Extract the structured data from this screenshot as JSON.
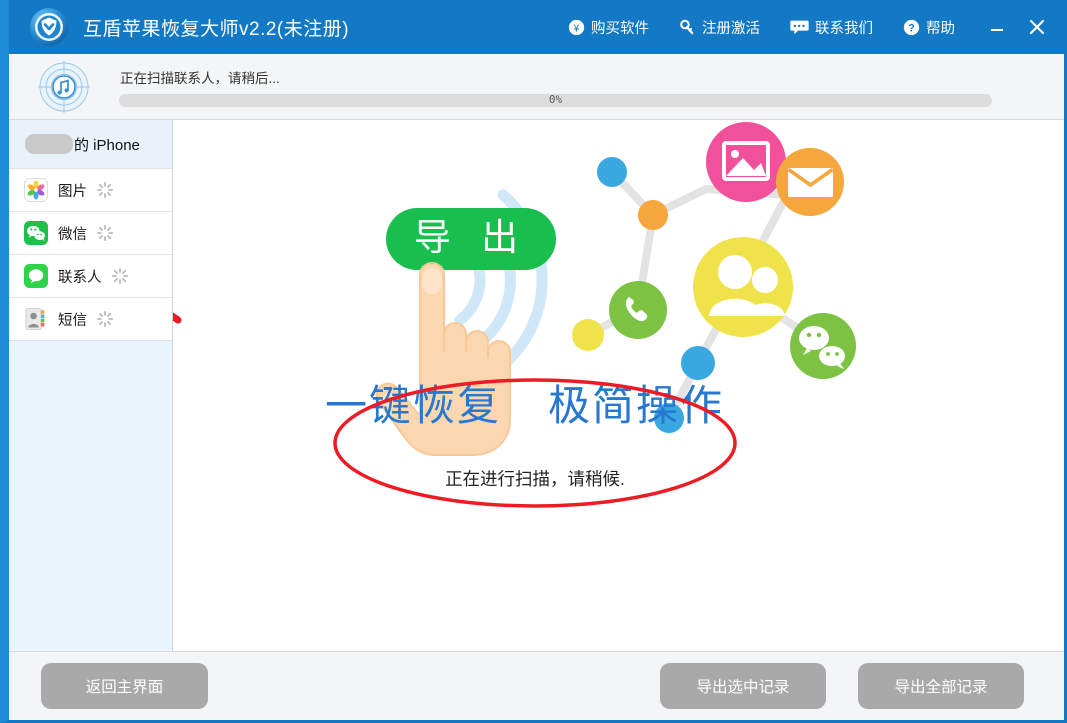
{
  "window": {
    "title": "互盾苹果恢复大师v2.2(未注册)",
    "logo_icon": "shield-logo-icon",
    "titlebar_color": "#1379c4",
    "minimize_label": "—",
    "close_label": "✕"
  },
  "toolbar": {
    "items": [
      {
        "label": "购买软件",
        "icon": "yen-coin-icon"
      },
      {
        "label": "注册激活",
        "icon": "key-icon"
      },
      {
        "label": "联系我们",
        "icon": "chat-bubble-icon"
      },
      {
        "label": "帮助",
        "icon": "question-mark-icon"
      }
    ]
  },
  "scan": {
    "icon": "radar-itunes-icon",
    "status_text": "正在扫描联系人，请稍后...",
    "progress_percent": "0%",
    "progress_value": 0
  },
  "sidebar": {
    "device": {
      "name_redacted": true,
      "label": "的 iPhone"
    },
    "items": [
      {
        "label": "图片",
        "icon": "photos-icon",
        "loading": true,
        "highlighted": false
      },
      {
        "label": "微信",
        "icon": "wechat-icon",
        "loading": true,
        "highlighted": true
      },
      {
        "label": "联系人",
        "icon": "contacts-bubble-icon",
        "loading": true,
        "highlighted": false
      },
      {
        "label": "短信",
        "icon": "sms-contact-card-icon",
        "loading": true,
        "highlighted": false
      }
    ]
  },
  "main": {
    "export_button_label": "导 出",
    "export_button_color": "#18bf4e",
    "slogan_left": "一键恢复",
    "slogan_right": "极简操作",
    "slogan_color": "#2878d0",
    "status_note": "正在进行扫描，请稍候.",
    "illustration": {
      "nodes": [
        {
          "name": "photos-node",
          "icon": "picture-icon",
          "color": "#f0519a"
        },
        {
          "name": "mail-node",
          "icon": "envelope-icon",
          "color": "#f5a63c"
        },
        {
          "name": "phone-node",
          "icon": "phone-icon",
          "color": "#7dc242"
        },
        {
          "name": "contacts-node",
          "icon": "people-icon",
          "color": "#f0e24a"
        },
        {
          "name": "wechat-node",
          "icon": "wechat-icon",
          "color": "#7dc242"
        }
      ],
      "wifi_arc_color": "#cfe7f7"
    },
    "annotations": {
      "ellipse_color": "#ec1c24",
      "arrow_color": "#ec1c24"
    }
  },
  "footer": {
    "back_label": "返回主界面",
    "export_selected_label": "导出选中记录",
    "export_all_label": "导出全部记录",
    "button_color": "#a9a9a9"
  }
}
